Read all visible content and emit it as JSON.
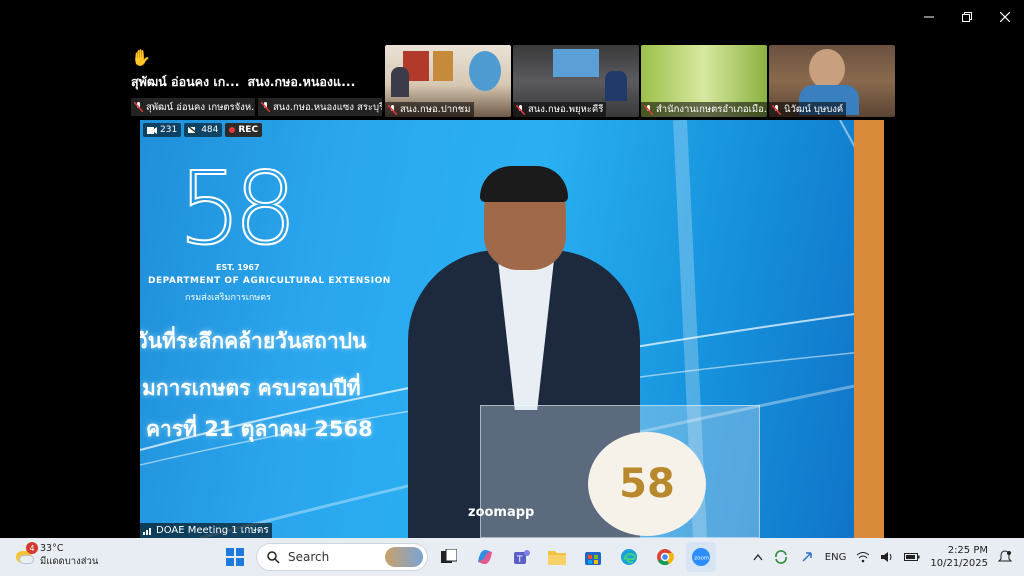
{
  "window": {
    "controls": [
      "minimize",
      "restore",
      "close"
    ]
  },
  "active_speaker": {
    "raise_hand_icon": "raised-hand-icon",
    "names_line": [
      "สุพัฒน์ อ่อนคง เก...",
      "สนง.กษอ.หนองแ..."
    ]
  },
  "name_tiles": [
    "สุพัฒน์ อ่อนคง เกษตรจังห...",
    "สนง.กษอ.หนองแซง สระบุรี"
  ],
  "thumbnails": [
    {
      "label": "สนง.กษอ.ปากชม"
    },
    {
      "label": "สนง.กษอ.พยุหะคีรี"
    },
    {
      "label": "สำนักงานเกษตรอำเภอเมือ..."
    },
    {
      "label": "นิวัฒน์ บุษบงค์"
    }
  ],
  "stage": {
    "viewer_count": "231",
    "attendee_count": "484",
    "rec_label": "REC",
    "logo_number": "58",
    "est_text": "EST. 1967",
    "dept_en": "DEPARTMENT OF AGRICULTURAL EXTENSION",
    "dept_th": "กรมส่งเสริมการเกษตร",
    "banner_lines": [
      "วันที่ระลึกคล้ายวันสถาปน",
      "มการเกษตร ครบรอบปีที่",
      "คารที่ 21 ตุลาคม 2568"
    ],
    "podium_number": "58",
    "zoomapp_label": "zoomapp",
    "meeting_label": "DOAE Meeting 1 เกษตร"
  },
  "taskbar": {
    "weather_badge": "4",
    "temperature": "33°C",
    "weather_desc": "มีแดดบางส่วน",
    "search_placeholder": "Search",
    "apps": [
      "windows-start",
      "search",
      "task-view",
      "copilot",
      "teams",
      "file-explorer",
      "store",
      "edge",
      "chrome",
      "zoom"
    ],
    "language": "ENG",
    "time": "2:25 PM",
    "date": "10/21/2025"
  },
  "colors": {
    "stage_blue": "#2aa6ee",
    "rec_red": "#e23b3b",
    "taskbar_bg": "#e8edf3",
    "tile_bg": "#282828"
  }
}
